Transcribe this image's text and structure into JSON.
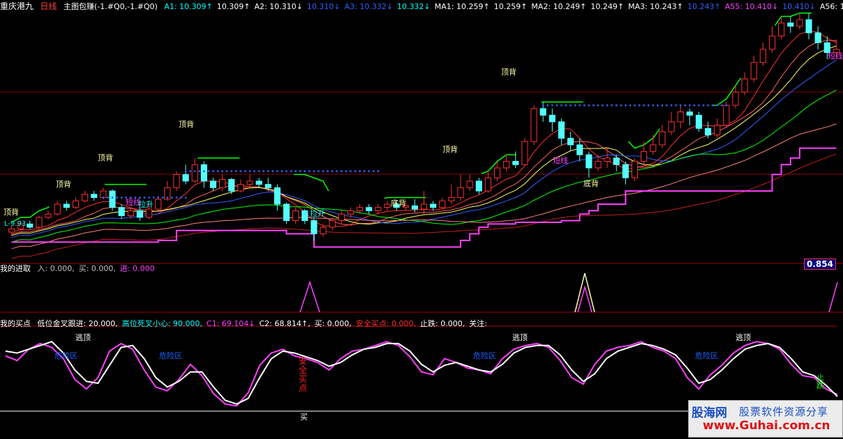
{
  "header": {
    "stock": "重庆港九",
    "period": "日线",
    "indicator": "主图包赚(-1.#Q0,-1.#Q0)",
    "items": [
      {
        "text": "A1: 10.309↑",
        "color": "#00ffff"
      },
      {
        "text": "10.309↑",
        "color": "#ffffff"
      },
      {
        "text": "A2: 10.310↓",
        "color": "#ffffff"
      },
      {
        "text": "10.310↓",
        "color": "#3060ff"
      },
      {
        "text": "A3: 10.332↓",
        "color": "#3060ff"
      },
      {
        "text": "10.332↓",
        "color": "#00ffff"
      },
      {
        "text": "MA1: 10.259↑",
        "color": "#ffffff"
      },
      {
        "text": "10.259↑",
        "color": "#ffffff"
      },
      {
        "text": "MA2: 10.249↑",
        "color": "#ffffff"
      },
      {
        "text": "10.249↑",
        "color": "#ffffff"
      },
      {
        "text": "MA3: 10.243↑",
        "color": "#ffffff"
      },
      {
        "text": "10.243↑",
        "color": "#3060ff"
      },
      {
        "text": "A55: 10.410↓",
        "color": "#ff40ff"
      },
      {
        "text": "10.410↓",
        "color": "#3060ff"
      },
      {
        "text": "A56: 1...",
        "color": "#ffffff"
      }
    ]
  },
  "panel2_header": {
    "title": "我的进取",
    "items": [
      {
        "text": "入: 0.000,",
        "color": "#c0c0c0"
      },
      {
        "text": "买: 0.000,",
        "color": "#c0c0c0"
      },
      {
        "text": "进: 0.000",
        "color": "#ff40ff"
      }
    ]
  },
  "panel2_value": "0.854",
  "panel3_header": {
    "title": "我的买点",
    "items": [
      {
        "text": "低位金叉跟进: 20.000,",
        "color": "#ffffff"
      },
      {
        "text": "高位死叉小心: 90.000,",
        "color": "#00ffff"
      },
      {
        "text": "C1: 69.104↓",
        "color": "#ff40ff"
      },
      {
        "text": "C2: 68.814↑,",
        "color": "#ffffff"
      },
      {
        "text": "买: 0.000,",
        "color": "#ffffff"
      },
      {
        "text": "安全买点: 0.000,",
        "color": "#ff3030"
      },
      {
        "text": "止跌: 0.000,",
        "color": "#ffffff"
      },
      {
        "text": "关注:",
        "color": "#ffffff"
      }
    ]
  },
  "annotations": {
    "top_divergence": "顶背",
    "bottom_divergence": "底背",
    "short_term": "短线",
    "pull_up": "拉升",
    "escape_top": "逃顶",
    "danger_zone": "危险区",
    "safe_buy": "安全买点",
    "buy": "买",
    "stop_fall": "止跌",
    "low_price": "L-9.93"
  },
  "watermark": {
    "logo": "股海网",
    "tagline": "股票软件资源分享",
    "url": "www.Guhai.com.cn"
  },
  "chart_data": [
    {
      "type": "candlestick",
      "title": "主图包赚",
      "candles": [
        [
          9.95,
          9.97,
          9.93,
          9.99
        ],
        [
          9.97,
          10.0,
          9.96,
          10.02
        ],
        [
          10.0,
          9.98,
          9.97,
          10.02
        ],
        [
          9.98,
          10.04,
          9.97,
          10.05
        ],
        [
          10.04,
          10.06,
          10.03,
          10.08
        ],
        [
          10.06,
          10.12,
          10.05,
          10.14
        ],
        [
          10.12,
          10.1,
          10.08,
          10.14
        ],
        [
          10.1,
          10.14,
          10.09,
          10.16
        ],
        [
          10.14,
          10.18,
          10.13,
          10.2
        ],
        [
          10.18,
          10.16,
          10.14,
          10.2
        ],
        [
          10.16,
          10.2,
          10.15,
          10.22
        ],
        [
          10.2,
          10.1,
          10.08,
          10.21
        ],
        [
          10.1,
          10.05,
          10.03,
          10.12
        ],
        [
          10.05,
          10.08,
          10.03,
          10.1
        ],
        [
          10.08,
          10.04,
          10.02,
          10.1
        ],
        [
          10.04,
          10.09,
          10.03,
          10.12
        ],
        [
          10.09,
          10.15,
          10.08,
          10.17
        ],
        [
          10.15,
          10.22,
          10.14,
          10.26
        ],
        [
          10.22,
          10.3,
          10.2,
          10.32
        ],
        [
          10.3,
          10.26,
          10.24,
          10.36
        ],
        [
          10.26,
          10.36,
          10.25,
          10.4
        ],
        [
          10.36,
          10.26,
          10.22,
          10.38
        ],
        [
          10.26,
          10.22,
          10.2,
          10.28
        ],
        [
          10.22,
          10.27,
          10.2,
          10.3
        ],
        [
          10.27,
          10.2,
          10.18,
          10.28
        ],
        [
          10.2,
          10.24,
          10.19,
          10.27
        ],
        [
          10.24,
          10.26,
          10.22,
          10.3
        ],
        [
          10.26,
          10.24,
          10.22,
          10.28
        ],
        [
          10.24,
          10.22,
          10.2,
          10.28
        ],
        [
          10.22,
          10.12,
          10.08,
          10.24
        ],
        [
          10.12,
          10.02,
          10.0,
          10.13
        ],
        [
          10.02,
          10.08,
          10.0,
          10.1
        ],
        [
          10.08,
          10.02,
          10.0,
          10.09
        ],
        [
          10.02,
          9.94,
          9.9,
          10.04
        ],
        [
          9.94,
          9.98,
          9.92,
          10.0
        ],
        [
          9.98,
          10.02,
          9.96,
          10.04
        ],
        [
          10.02,
          10.06,
          10.0,
          10.08
        ],
        [
          10.06,
          10.08,
          10.04,
          10.1
        ],
        [
          10.08,
          10.1,
          10.06,
          10.12
        ],
        [
          10.1,
          10.08,
          10.06,
          10.12
        ],
        [
          10.08,
          10.1,
          10.06,
          10.12
        ],
        [
          10.1,
          10.12,
          10.08,
          10.14
        ],
        [
          10.12,
          10.1,
          10.08,
          10.14
        ],
        [
          10.1,
          10.11,
          10.08,
          10.13
        ],
        [
          10.11,
          10.09,
          10.07,
          10.15
        ],
        [
          10.09,
          10.12,
          10.06,
          10.2
        ],
        [
          10.12,
          10.1,
          10.08,
          10.14
        ],
        [
          10.1,
          10.14,
          10.09,
          10.16
        ],
        [
          10.14,
          10.16,
          10.12,
          10.24
        ],
        [
          10.16,
          10.22,
          10.14,
          10.3
        ],
        [
          10.22,
          10.26,
          10.2,
          10.3
        ],
        [
          10.26,
          10.2,
          10.18,
          10.28
        ],
        [
          10.2,
          10.28,
          10.19,
          10.32
        ],
        [
          10.28,
          10.34,
          10.26,
          10.38
        ],
        [
          10.34,
          10.38,
          10.32,
          10.42
        ],
        [
          10.38,
          10.36,
          10.34,
          10.44
        ],
        [
          10.36,
          10.5,
          10.35,
          10.52
        ],
        [
          10.5,
          10.7,
          10.48,
          10.72
        ],
        [
          10.7,
          10.66,
          10.62,
          10.74
        ],
        [
          10.66,
          10.62,
          10.56,
          10.7
        ],
        [
          10.62,
          10.52,
          10.48,
          10.64
        ],
        [
          10.52,
          10.48,
          10.44,
          10.56
        ],
        [
          10.48,
          10.42,
          10.38,
          10.52
        ],
        [
          10.42,
          10.34,
          10.28,
          10.44
        ],
        [
          10.34,
          10.38,
          10.32,
          10.42
        ],
        [
          10.38,
          10.4,
          10.34,
          10.46
        ],
        [
          10.4,
          10.36,
          10.32,
          10.42
        ],
        [
          10.36,
          10.28,
          10.24,
          10.38
        ],
        [
          10.28,
          10.38,
          10.26,
          10.4
        ],
        [
          10.38,
          10.44,
          10.36,
          10.5
        ],
        [
          10.44,
          10.48,
          10.42,
          10.54
        ],
        [
          10.48,
          10.56,
          10.46,
          10.6
        ],
        [
          10.56,
          10.62,
          10.54,
          10.68
        ],
        [
          10.62,
          10.68,
          10.58,
          10.72
        ],
        [
          10.68,
          10.66,
          10.6,
          10.7
        ],
        [
          10.66,
          10.58,
          10.56,
          10.68
        ],
        [
          10.58,
          10.54,
          10.52,
          10.62
        ],
        [
          10.54,
          10.6,
          10.52,
          10.64
        ],
        [
          10.6,
          10.72,
          10.58,
          10.74
        ],
        [
          10.72,
          10.8,
          10.7,
          10.84
        ],
        [
          10.8,
          10.88,
          10.78,
          10.92
        ],
        [
          10.88,
          10.98,
          10.86,
          11.02
        ],
        [
          10.98,
          11.06,
          10.96,
          11.1
        ],
        [
          11.06,
          11.14,
          11.04,
          11.2
        ],
        [
          11.14,
          11.22,
          11.12,
          11.26
        ],
        [
          11.22,
          11.2,
          11.16,
          11.26
        ],
        [
          11.2,
          11.24,
          11.18,
          11.28
        ],
        [
          11.24,
          11.16,
          11.12,
          11.28
        ],
        [
          11.16,
          11.1,
          11.06,
          11.2
        ],
        [
          11.1,
          11.04,
          11.0,
          11.14
        ],
        [
          11.04,
          11.06,
          11.0,
          11.12
        ]
      ],
      "ylim": [
        9.9,
        11.3
      ]
    },
    {
      "type": "line",
      "title": "我的买点",
      "series": [
        {
          "name": "C1",
          "color": "#ff40ff",
          "values": [
            65,
            60,
            72,
            78,
            74,
            62,
            40,
            30,
            42,
            70,
            78,
            72,
            50,
            32,
            28,
            40,
            56,
            44,
            25,
            14,
            12,
            26,
            55,
            68,
            72,
            65,
            62,
            58,
            50,
            62,
            70,
            72,
            76,
            80,
            76,
            64,
            48,
            45,
            62,
            58,
            52,
            50,
            46,
            62,
            72,
            76,
            78,
            74,
            60,
            42,
            35,
            56,
            70,
            74,
            76,
            80,
            74,
            70,
            62,
            42,
            30,
            45,
            55,
            68,
            76,
            80,
            78,
            72,
            56,
            44,
            42,
            30,
            24
          ]
        },
        {
          "name": "C2",
          "color": "#ffffff",
          "values": [
            70,
            68,
            72,
            76,
            80,
            68,
            50,
            38,
            36,
            55,
            74,
            76,
            62,
            42,
            32,
            38,
            48,
            48,
            32,
            18,
            14,
            20,
            42,
            62,
            70,
            68,
            64,
            60,
            54,
            58,
            66,
            72,
            74,
            78,
            78,
            70,
            56,
            48,
            55,
            58,
            54,
            50,
            48,
            56,
            68,
            74,
            76,
            76,
            66,
            50,
            38,
            46,
            62,
            70,
            74,
            78,
            76,
            72,
            66,
            52,
            36,
            40,
            50,
            62,
            72,
            76,
            78,
            74,
            62,
            48,
            44,
            34,
            22
          ]
        }
      ],
      "ylim": [
        5,
        95
      ]
    }
  ]
}
